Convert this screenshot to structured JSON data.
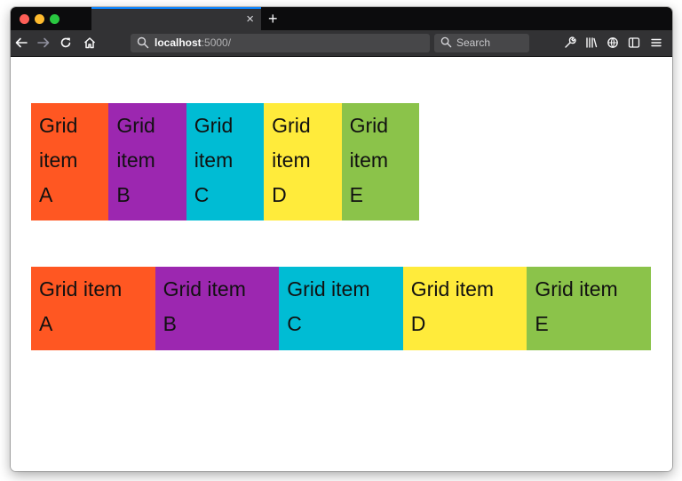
{
  "browser": {
    "tab_close_glyph": "×",
    "new_tab_glyph": "+",
    "url": {
      "host": "localhost",
      "path": ":5000/"
    },
    "search_placeholder": "Search",
    "toolbar_icons": [
      "back-icon",
      "forward-icon",
      "reload-icon",
      "home-icon",
      "wrench-icon",
      "library-icon",
      "extensions-icon",
      "sidebar-icon",
      "menu-icon"
    ]
  },
  "grids": [
    {
      "items": [
        {
          "line1": "Grid",
          "line2": "item",
          "line3": "A",
          "color": "#ff5722"
        },
        {
          "line1": "Grid",
          "line2": "item",
          "line3": "B",
          "color": "#9c27b0"
        },
        {
          "line1": "Grid",
          "line2": "item",
          "line3": "C",
          "color": "#00bcd4"
        },
        {
          "line1": "Grid",
          "line2": "item",
          "line3": "D",
          "color": "#ffeb3b"
        },
        {
          "line1": "Grid",
          "line2": "item",
          "line3": "E",
          "color": "#8bc34a"
        }
      ]
    },
    {
      "items": [
        {
          "line1": "Grid item",
          "line2": "A",
          "color": "#ff5722"
        },
        {
          "line1": "Grid item",
          "line2": "B",
          "color": "#9c27b0"
        },
        {
          "line1": "Grid item",
          "line2": "C",
          "color": "#00bcd4"
        },
        {
          "line1": "Grid item",
          "line2": "D",
          "color": "#ffeb3b"
        },
        {
          "line1": "Grid item",
          "line2": "E",
          "color": "#8bc34a"
        }
      ]
    }
  ]
}
